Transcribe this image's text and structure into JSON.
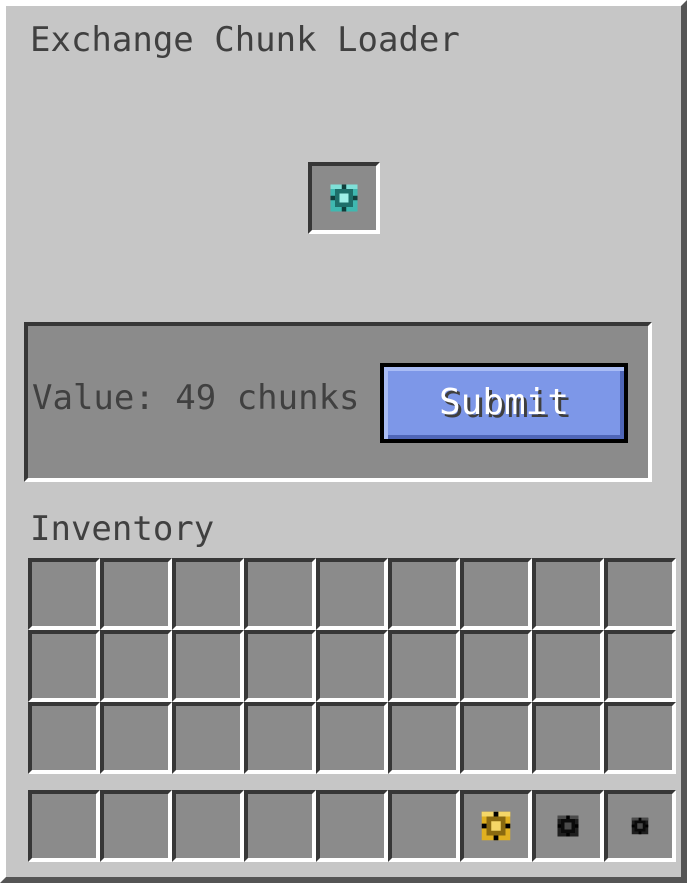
{
  "window": {
    "title": "Exchange Chunk Loader"
  },
  "selected_item": {
    "name": "exchange-chunk-loader",
    "color": "#3fb8b0"
  },
  "value_panel": {
    "value_text": "Value: 49 chunks",
    "submit_label": "Submit"
  },
  "inventory": {
    "label": "Inventory",
    "main_rows": [
      [
        null,
        null,
        null,
        null,
        null,
        null,
        null,
        null,
        null
      ],
      [
        null,
        null,
        null,
        null,
        null,
        null,
        null,
        null,
        null
      ],
      [
        null,
        null,
        null,
        null,
        null,
        null,
        null,
        null,
        null
      ]
    ],
    "hotbar": [
      null,
      null,
      null,
      null,
      null,
      null,
      {
        "icon": "gold-chunk-loader-icon",
        "color": "#e0b020",
        "size": "large"
      },
      {
        "icon": "black-chunk-loader-icon",
        "color": "#1e1e1e",
        "size": "medium"
      },
      {
        "icon": "small-black-chunk-loader-icon",
        "color": "#1e1e1e",
        "size": "small"
      }
    ]
  },
  "colors": {
    "background": "#c6c6c6",
    "slot": "#8b8b8b",
    "button": "#7d97e8",
    "text": "#404040"
  }
}
